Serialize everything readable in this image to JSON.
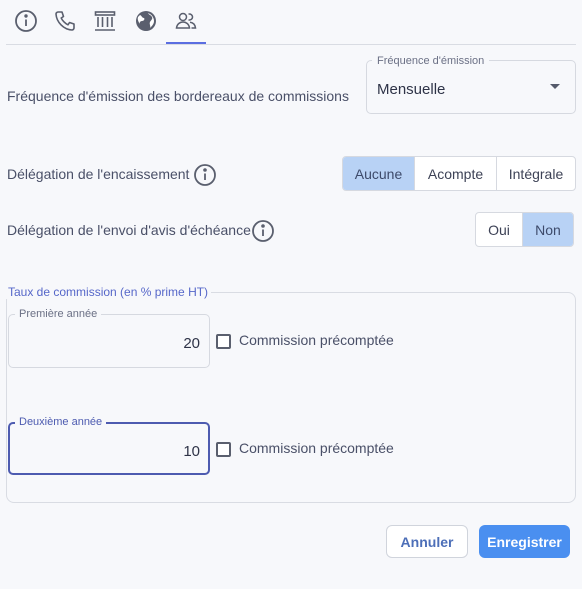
{
  "tabs": [
    {
      "name": "info-tab",
      "icon": "info-icon"
    },
    {
      "name": "phone-tab",
      "icon": "phone-icon"
    },
    {
      "name": "bank-tab",
      "icon": "bank-icon"
    },
    {
      "name": "globe-tab",
      "icon": "globe-icon"
    },
    {
      "name": "people-tab",
      "icon": "people-icon",
      "active": true
    }
  ],
  "frequency": {
    "label": "Fréquence d'émission des bordereaux de commissions",
    "select_legend": "Fréquence d'émission",
    "select_value": "Mensuelle"
  },
  "encaissement": {
    "label": "Délégation de l'encaissement",
    "options": [
      "Aucune",
      "Acompte",
      "Intégrale"
    ],
    "selected": "Aucune"
  },
  "avis": {
    "label": "Délégation de l'envoi d'avis d'échéance",
    "options": [
      "Oui",
      "Non"
    ],
    "selected": "Non"
  },
  "commission": {
    "legend": "Taux de commission (en % prime HT)",
    "first_year": {
      "legend": "Première année",
      "value": "20",
      "checkbox_label": "Commission précomptée",
      "checked": false
    },
    "second_year": {
      "legend": "Deuxième année",
      "value": "10",
      "checkbox_label": "Commission précomptée",
      "checked": false
    }
  },
  "footer": {
    "cancel_label": "Annuler",
    "save_label": "Enregistrer"
  },
  "colors": {
    "accent": "#5b6ee1",
    "toggle_active": "#b8d2f5",
    "primary_button": "#4a8ff0"
  }
}
